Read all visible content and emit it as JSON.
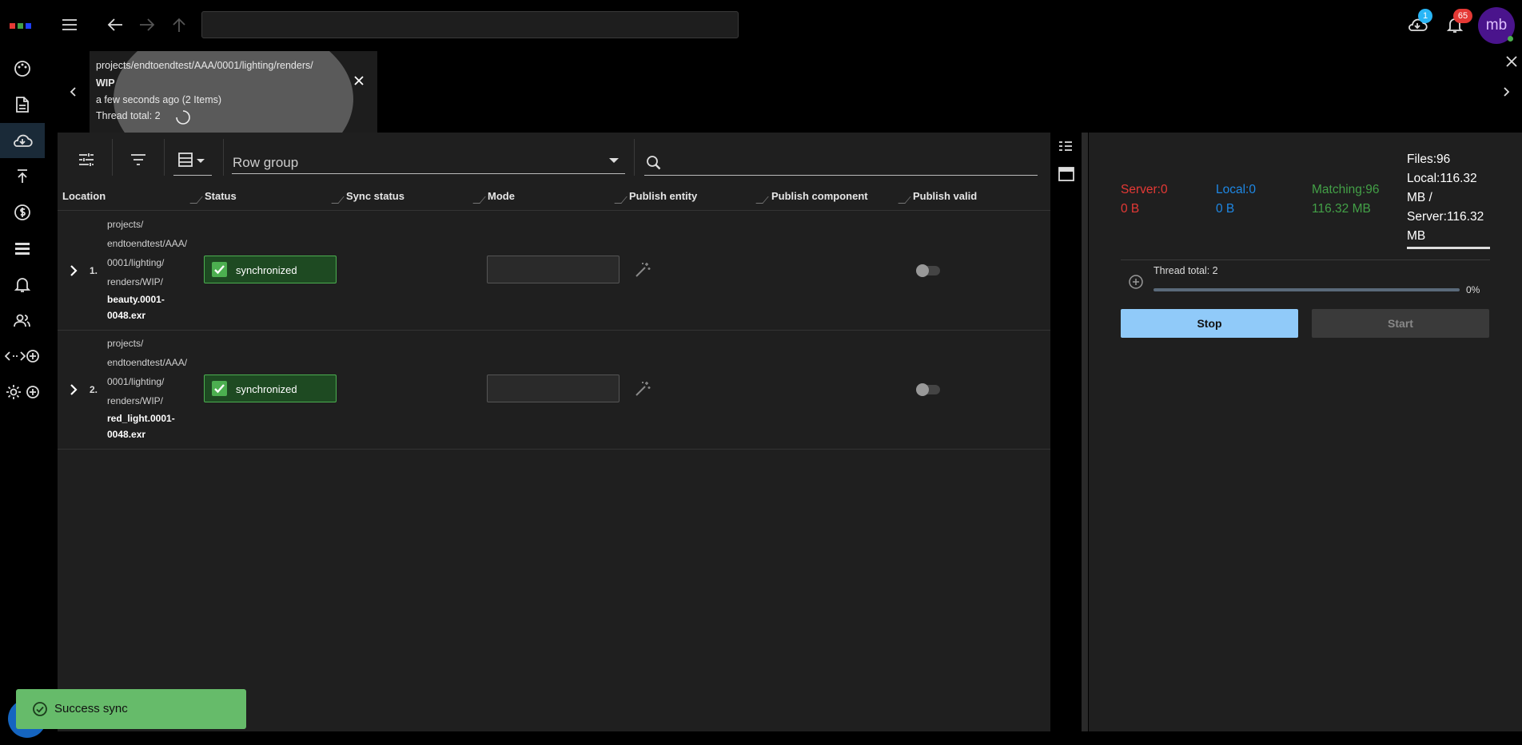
{
  "topbar": {
    "url_value": "",
    "sync_badge": "1",
    "notifications_badge": "65",
    "avatar_initials": "mb",
    "colors": {
      "sync_badge": "#29b6f6",
      "notifications_badge": "#e53935",
      "avatar": "#4a148c"
    }
  },
  "recent_tab": {
    "path": "projects/endtoendtest/AAA/0001/lighting/renders/",
    "folder": "WIP",
    "time": "a few seconds ago (2 Items)",
    "threads": "Thread total: 2"
  },
  "toolbar": {
    "row_group_placeholder": "Row group",
    "search_value": ""
  },
  "table": {
    "columns": [
      "Location",
      "Status",
      "Sync status",
      "Mode",
      "Publish entity",
      "Publish component",
      "Publish valid"
    ],
    "rows": [
      {
        "index": "1.",
        "location_lines": [
          "projects/",
          "endtoendtest/AAA/",
          "0001/lighting/",
          "renders/WIP/"
        ],
        "filename_lines": [
          "beauty.0001-",
          "0048.exr"
        ],
        "status": "synchronized",
        "mode": ""
      },
      {
        "index": "2.",
        "location_lines": [
          "projects/",
          "endtoendtest/AAA/",
          "0001/lighting/",
          "renders/WIP/"
        ],
        "filename_lines": [
          "red_light.0001-",
          "0048.exr"
        ],
        "status": "synchronized",
        "mode": ""
      }
    ]
  },
  "summary": {
    "server_count": "Server:0",
    "server_size": "0 B",
    "local_count": "Local:0",
    "local_size": "0 B",
    "matching_count": "Matching:96",
    "matching_size": "116.32 MB",
    "files": "Files:96",
    "size_lines": [
      "Local:116.32",
      "MB /",
      "Server:116.32",
      "MB"
    ],
    "thread_total": "Thread total: 2",
    "progress_label": "0%",
    "progress": 0,
    "stop_label": "Stop",
    "start_label": "Start",
    "colors": {
      "server": "#e53935",
      "local": "#1e88e5",
      "matching": "#43a047"
    }
  },
  "toast": {
    "message": "Success sync"
  }
}
